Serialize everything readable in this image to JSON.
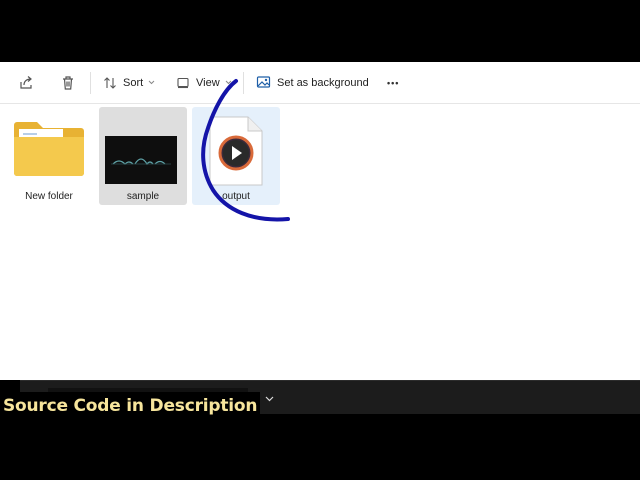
{
  "toolbar": {
    "sort_label": "Sort",
    "view_label": "View",
    "set_background_label": "Set as background",
    "more_label": "•••"
  },
  "files": [
    {
      "name": "New folder",
      "kind": "folder"
    },
    {
      "name": "sample",
      "kind": "video-thumbnail",
      "selected": true
    },
    {
      "name": "output",
      "kind": "video-file",
      "hovered": true
    }
  ],
  "overlay": {
    "caption": "Source Code in  Description"
  },
  "icons": {
    "share": "share-icon",
    "delete": "trash-icon",
    "sort": "sort-icon",
    "view": "view-icon",
    "background": "image-icon",
    "more": "more-icon",
    "chevron": "chevron-down-icon"
  },
  "colors": {
    "selection": "#dedede",
    "hover": "#e5f0fb",
    "caption_text": "#f7e59c",
    "annotation": "#1414a8",
    "folder": "#f4c94d"
  }
}
